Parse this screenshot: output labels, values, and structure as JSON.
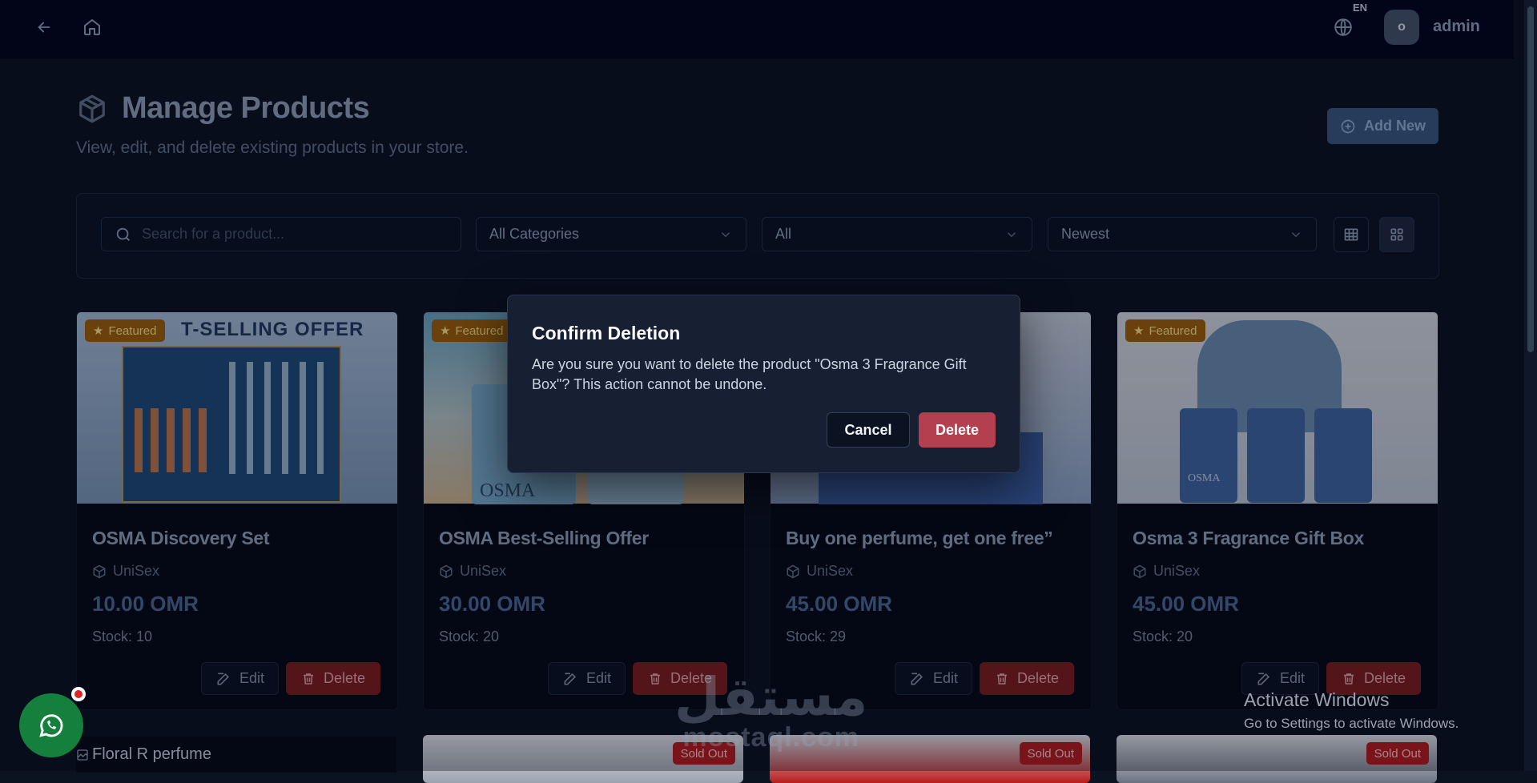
{
  "topbar": {
    "lang": "EN",
    "avatar_initial": "o",
    "user": "admin"
  },
  "header": {
    "title": "Manage Products",
    "subtitle": "View, edit, and delete existing products in your store.",
    "add_label": "Add New"
  },
  "filters": {
    "search_placeholder": "Search for a product...",
    "category": "All Categories",
    "status": "All",
    "sort": "Newest"
  },
  "products": [
    {
      "badge": "Featured",
      "image_text": "T-SELLING OFFER",
      "name": "OSMA Discovery Set",
      "category": "UniSex",
      "price": "10.00 OMR",
      "stock": "Stock: 10",
      "edit": "Edit",
      "delete": "Delete"
    },
    {
      "badge": "Featured",
      "image_text": "OSMA",
      "name": "OSMA Best-Selling Offer",
      "category": "UniSex",
      "price": "30.00 OMR",
      "stock": "Stock: 20",
      "edit": "Edit",
      "delete": "Delete"
    },
    {
      "badge": "",
      "image_text": "",
      "name": "Buy one perfume, get one free”",
      "category": "UniSex",
      "price": "45.00 OMR",
      "stock": "Stock: 29",
      "edit": "Edit",
      "delete": "Delete"
    },
    {
      "badge": "Featured",
      "image_text": "OSMA",
      "name": "Osma 3 Fragrance Gift Box",
      "category": "UniSex",
      "price": "45.00 OMR",
      "stock": "Stock: 20",
      "edit": "Edit",
      "delete": "Delete"
    }
  ],
  "row2": {
    "broken_alt": "Floral R perfume",
    "soldout_label": "Sold Out"
  },
  "modal": {
    "title": "Confirm Deletion",
    "message": "Are you sure you want to delete the product \"Osma 3 Fragrance Gift Box\"? This action cannot be undone.",
    "cancel": "Cancel",
    "delete": "Delete"
  },
  "watermark": {
    "arabic": "مستقل",
    "latin": "mostaql.com"
  },
  "activation": {
    "title": "Activate Windows",
    "message": "Go to Settings to activate Windows."
  },
  "colors": {
    "accent": "#3b5a80",
    "danger": "#b4404f",
    "featured": "#a16207",
    "whatsapp": "#15803d"
  }
}
